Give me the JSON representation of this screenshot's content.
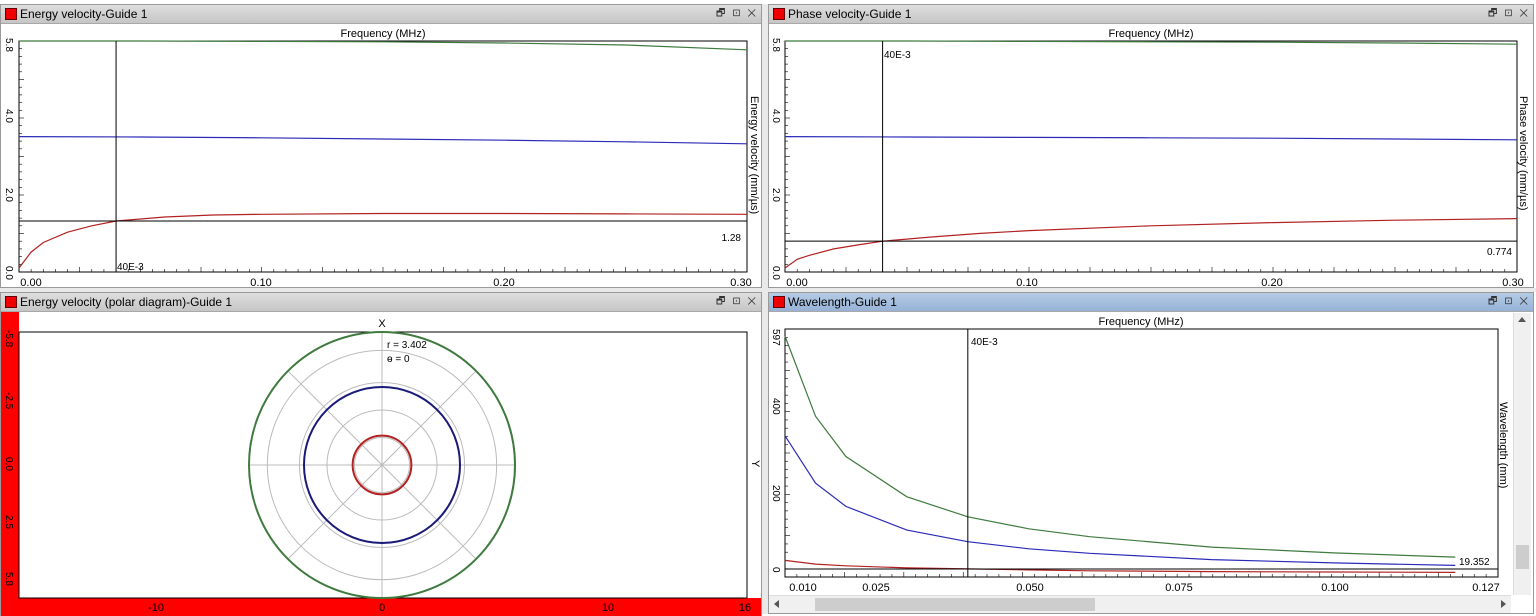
{
  "colors": {
    "green": "#3f7a3f",
    "blue": "#2b2bb8",
    "red": "#b22222",
    "navy": "#1a1a78",
    "red_fill": "#ff0000"
  },
  "window_buttons": {
    "restore": "🗗",
    "pin": "⊡",
    "close": "✕"
  },
  "panels": {
    "energy": {
      "title": "Energy velocity-Guide 1",
      "top_axis_label": "Frequency (MHz)",
      "right_axis_label": "Energy velocity (mm/µs)",
      "x_ticks": [
        "0.00",
        "0.10",
        "0.20",
        "0.30"
      ],
      "y_ticks": [
        "0.0",
        "2.0",
        "4.0",
        "5.8"
      ],
      "cursor_x_label": "40E-3",
      "cursor_y_label": "1.28"
    },
    "phase": {
      "title": "Phase velocity-Guide 1",
      "top_axis_label": "Frequency (MHz)",
      "right_axis_label": "Phase velocity (mm/µs)",
      "x_ticks": [
        "0.00",
        "0.10",
        "0.20",
        "0.30"
      ],
      "y_ticks": [
        "0.0",
        "2.0",
        "4.0",
        "5.8"
      ],
      "cursor_x_label": "40E-3",
      "cursor_y_label": "0.774"
    },
    "polar": {
      "title": "Energy velocity (polar diagram)-Guide 1",
      "axis_x_label": "X",
      "axis_y_label": "Y",
      "readout_r": "r = 3.402",
      "readout_theta": "ɵ = 0",
      "left_ticks": [
        "-5.8",
        "-2.5",
        "0.0",
        "2.5",
        "5.8"
      ],
      "bottom_ticks": [
        "-10",
        "0",
        "10",
        "16"
      ]
    },
    "wavelength": {
      "title": "Wavelength-Guide 1",
      "top_axis_label": "Frequency (MHz)",
      "right_axis_label": "Wavelength (mm)",
      "x_ticks": [
        "0.010",
        "0.025",
        "0.050",
        "0.075",
        "0.100",
        "0.127"
      ],
      "y_ticks": [
        "0",
        "200",
        "400",
        "597"
      ],
      "cursor_x_label": "40E-3",
      "cursor_y_label": "19.352"
    }
  },
  "chart_data": [
    {
      "type": "line",
      "title": "Energy velocity-Guide 1",
      "xlabel": "Frequency (MHz)",
      "ylabel": "Energy velocity (mm/µs)",
      "xlim": [
        0,
        0.3
      ],
      "ylim": [
        0,
        5.8
      ],
      "series": [
        {
          "color": "green",
          "x": [
            0,
            0.05,
            0.1,
            0.15,
            0.2,
            0.25,
            0.3
          ],
          "y": [
            5.8,
            5.8,
            5.79,
            5.78,
            5.75,
            5.7,
            5.58
          ]
        },
        {
          "color": "blue",
          "x": [
            0,
            0.05,
            0.1,
            0.15,
            0.2,
            0.25,
            0.3
          ],
          "y": [
            3.4,
            3.39,
            3.37,
            3.34,
            3.31,
            3.27,
            3.22
          ]
        },
        {
          "color": "red",
          "x": [
            0,
            0.005,
            0.01,
            0.02,
            0.03,
            0.04,
            0.06,
            0.08,
            0.1,
            0.15,
            0.2,
            0.25,
            0.3
          ],
          "y": [
            0.1,
            0.5,
            0.74,
            1.0,
            1.16,
            1.28,
            1.38,
            1.43,
            1.45,
            1.47,
            1.47,
            1.46,
            1.45
          ]
        }
      ],
      "cursor": {
        "x": 0.04,
        "y": 1.28
      }
    },
    {
      "type": "line",
      "title": "Phase velocity-Guide 1",
      "xlabel": "Frequency (MHz)",
      "ylabel": "Phase velocity (mm/µs)",
      "xlim": [
        0,
        0.3
      ],
      "ylim": [
        0,
        5.8
      ],
      "series": [
        {
          "color": "green",
          "x": [
            0,
            0.05,
            0.1,
            0.15,
            0.2,
            0.25,
            0.3
          ],
          "y": [
            5.8,
            5.8,
            5.79,
            5.78,
            5.77,
            5.75,
            5.72
          ]
        },
        {
          "color": "blue",
          "x": [
            0,
            0.05,
            0.1,
            0.15,
            0.2,
            0.25,
            0.3
          ],
          "y": [
            3.4,
            3.39,
            3.38,
            3.37,
            3.36,
            3.34,
            3.32
          ]
        },
        {
          "color": "red",
          "x": [
            0,
            0.005,
            0.01,
            0.02,
            0.03,
            0.04,
            0.06,
            0.08,
            0.1,
            0.15,
            0.2,
            0.25,
            0.3
          ],
          "y": [
            0.1,
            0.32,
            0.42,
            0.58,
            0.68,
            0.774,
            0.88,
            0.97,
            1.04,
            1.16,
            1.24,
            1.3,
            1.34
          ]
        }
      ],
      "cursor": {
        "x": 0.04,
        "y": 0.774
      }
    },
    {
      "type": "scatter",
      "title": "Energy velocity (polar diagram)-Guide 1",
      "xlabel": "X",
      "ylabel": "Y",
      "series": [
        {
          "color": "green",
          "radius": 5.8
        },
        {
          "color": "navy",
          "radius": 3.402
        },
        {
          "color": "red",
          "radius": 1.28
        }
      ],
      "readout": {
        "r": 3.402,
        "theta": 0
      }
    },
    {
      "type": "line",
      "title": "Wavelength-Guide 1",
      "xlabel": "Frequency (MHz)",
      "ylabel": "Wavelength (mm)",
      "xlim": [
        0.01,
        0.127
      ],
      "ylim": [
        0,
        597
      ],
      "series": [
        {
          "color": "green",
          "x": [
            0.0095,
            0.015,
            0.02,
            0.03,
            0.04,
            0.05,
            0.06,
            0.08,
            0.1,
            0.12
          ],
          "y": [
            580,
            387,
            290,
            193,
            145,
            116,
            97,
            72,
            58,
            48
          ]
        },
        {
          "color": "blue",
          "x": [
            0.0095,
            0.015,
            0.02,
            0.03,
            0.04,
            0.05,
            0.06,
            0.08,
            0.1,
            0.12
          ],
          "y": [
            340,
            226,
            170,
            113,
            85,
            68,
            57,
            42,
            34,
            28
          ]
        },
        {
          "color": "red",
          "x": [
            0.0095,
            0.015,
            0.02,
            0.03,
            0.04,
            0.05,
            0.06,
            0.08,
            0.1,
            0.12
          ],
          "y": [
            40,
            31,
            27,
            22,
            19.4,
            17,
            15,
            13,
            12,
            11
          ]
        }
      ],
      "cursor": {
        "x": 0.04,
        "y": 19.352
      }
    }
  ]
}
